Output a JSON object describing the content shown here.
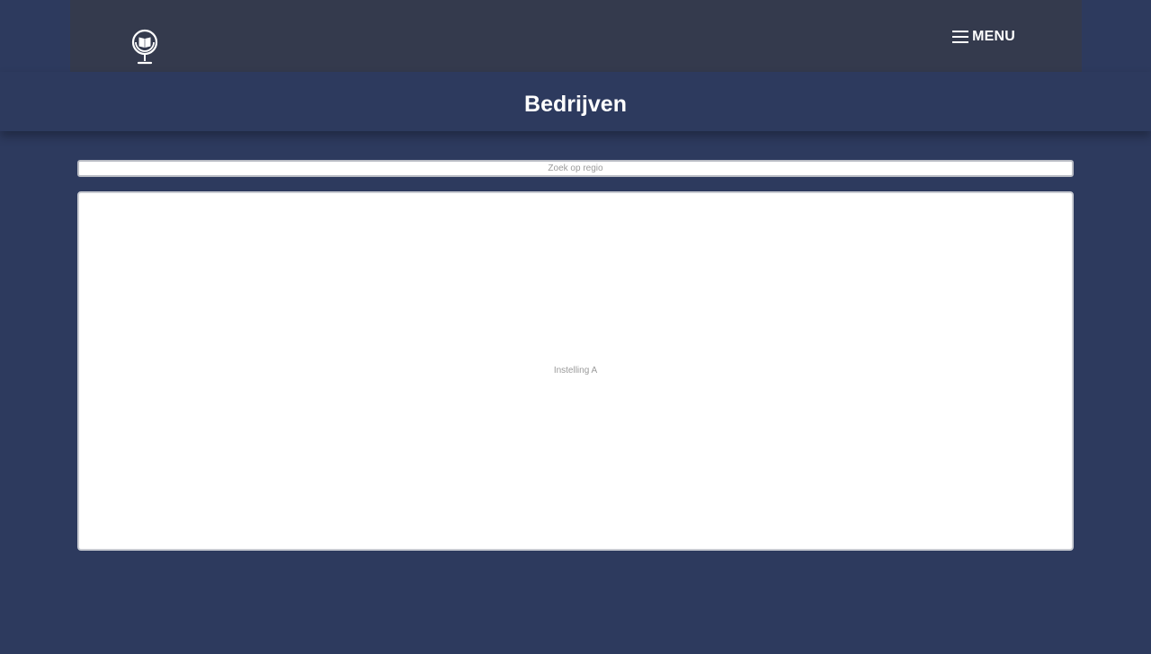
{
  "header": {
    "logo_icon": "globe-book-icon",
    "menu_icon": "hamburger-icon",
    "menu_label": "MENU"
  },
  "page": {
    "title": "Bedrijven"
  },
  "search": {
    "placeholder": "Zoek op regio",
    "value": ""
  },
  "results": {
    "items": [
      {
        "label": "Instelling A"
      }
    ]
  },
  "colors": {
    "background": "#2d3a5e",
    "topbar": "#343a4d",
    "text_light": "#ffffff",
    "muted_text": "#9a9a9a"
  }
}
